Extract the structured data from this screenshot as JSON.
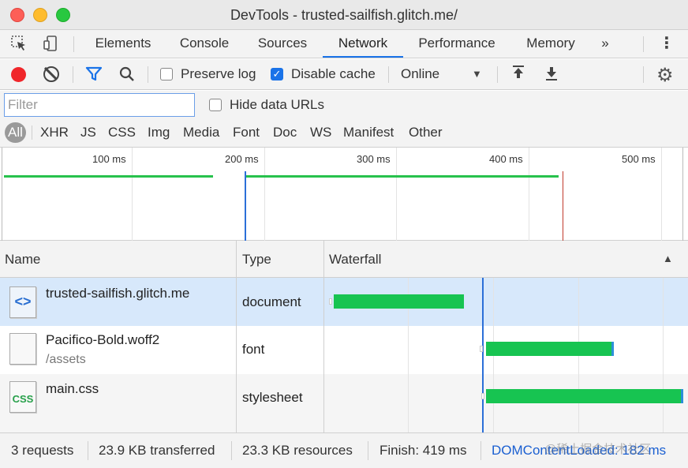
{
  "window": {
    "title": "DevTools - trusted-sailfish.glitch.me/"
  },
  "tabs": [
    {
      "label": "Elements"
    },
    {
      "label": "Console"
    },
    {
      "label": "Sources"
    },
    {
      "label": "Network",
      "active": true
    },
    {
      "label": "Performance"
    },
    {
      "label": "Memory"
    }
  ],
  "more_tabs_label": "»",
  "toolbar": {
    "preserve_log_label": "Preserve log",
    "preserve_log_checked": false,
    "disable_cache_label": "Disable cache",
    "disable_cache_checked": true,
    "throttling_value": "Online",
    "record_color": "#f0262a"
  },
  "filter": {
    "placeholder": "Filter",
    "value": "",
    "hide_data_urls_label": "Hide data URLs",
    "types": [
      "All",
      "XHR",
      "JS",
      "CSS",
      "Img",
      "Media",
      "Font",
      "Doc",
      "WS",
      "Manifest",
      "Other"
    ],
    "active_type": "All"
  },
  "overview": {
    "ticks": [
      "100 ms",
      "200 ms",
      "300 ms",
      "400 ms",
      "500 ms"
    ]
  },
  "table": {
    "headers": {
      "name": "Name",
      "type": "Type",
      "waterfall": "Waterfall"
    },
    "rows": [
      {
        "name": "trusted-sailfish.glitch.me",
        "sub": "",
        "type": "document",
        "icon": "html-document-icon",
        "icon_glyph": "<>"
      },
      {
        "name": "Pacifico-Bold.woff2",
        "sub": "/assets",
        "type": "font",
        "icon": "blank-file-icon",
        "icon_glyph": ""
      },
      {
        "name": "main.css",
        "sub": "",
        "type": "stylesheet",
        "icon": "css-file-icon",
        "icon_glyph": "CSS"
      }
    ]
  },
  "status": {
    "requests": "3 requests",
    "transferred": "23.9 KB transferred",
    "resources": "23.3 KB resources",
    "finish": "Finish: 419 ms",
    "dom_content_loaded": "DOMContentLoaded: 182 ms"
  },
  "watermark": "@稀土掘金技术社区",
  "colors": {
    "accent": "#1a73e8",
    "waterfall_bar": "#17c451",
    "dcl_line": "#2b6fd8",
    "load_line": "#c0392b"
  }
}
